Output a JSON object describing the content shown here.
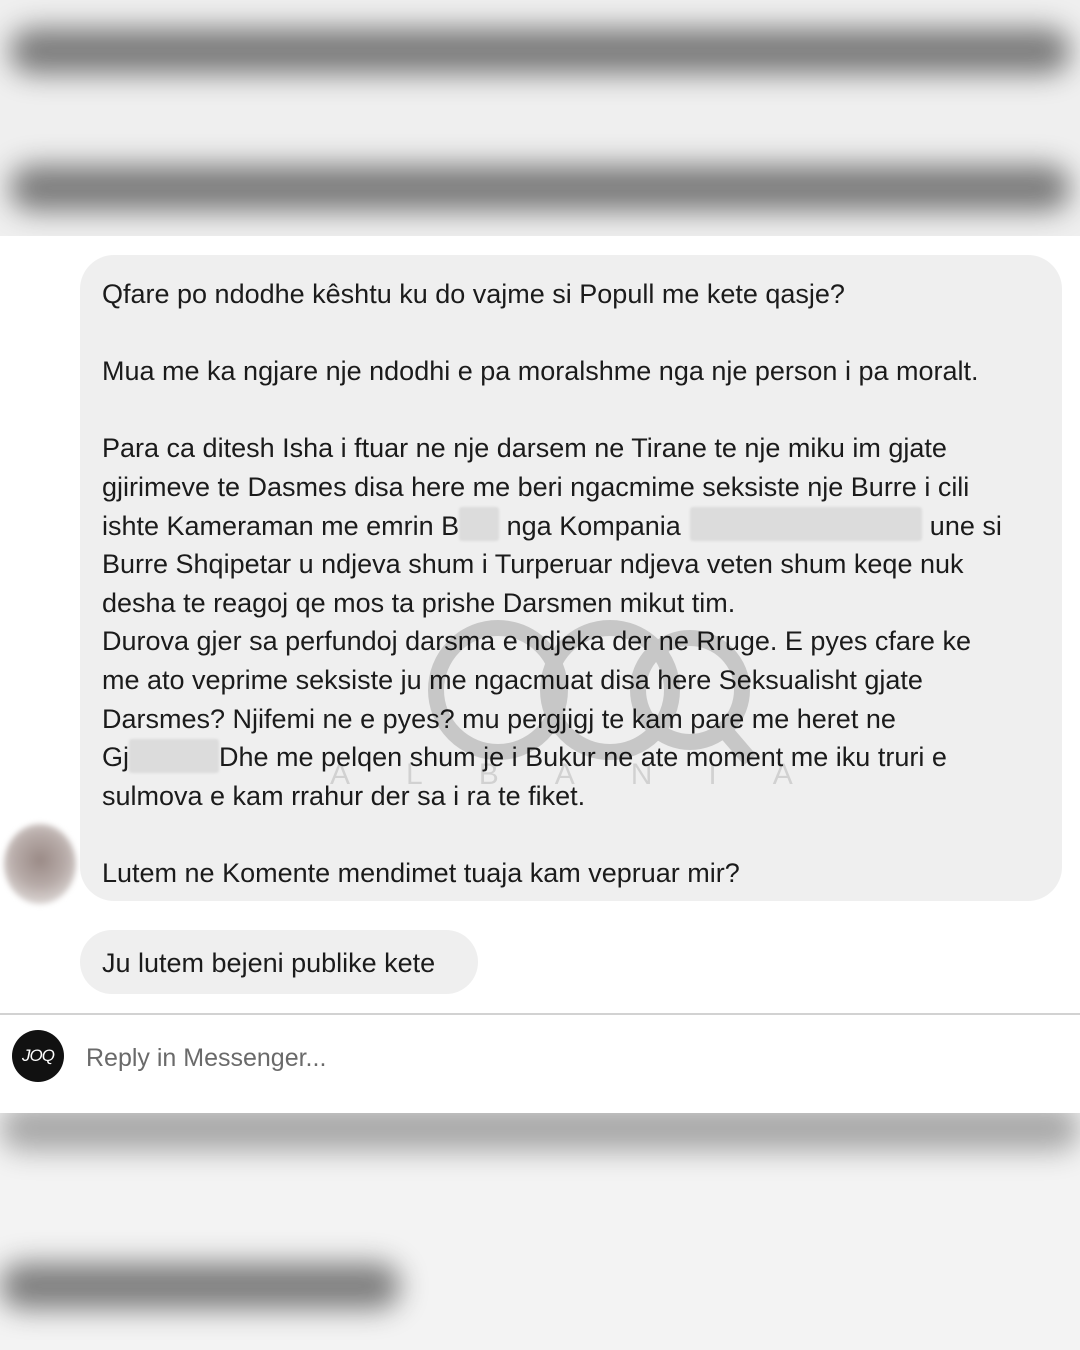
{
  "message_main": {
    "line1": "Qfare po ndodhe kêshtu ku do vajme si Popull me kete qasje?",
    "line2": "Mua me ka ngjare nje ndodhi e pa moralshme nga nje person i pa moralt.",
    "line3": "Para ca ditesh Isha i ftuar ne nje darsem ne Tirane te nje miku im gjate",
    "line4": "gjirimeve te Dasmes disa here me beri ngacmime seksiste nje Burre i cili",
    "line5_a": "ishte Kameraman me emrin B",
    "line5_b": " nga Kompania ",
    "line5_c": "une si",
    "line6": "Burre Shqipetar u ndjeva shum i Turperuar ndjeva veten shum keqe nuk",
    "line7": "desha te reagoj qe mos ta prishe Darsmen mikut tim.",
    "line8": "Durova gjer sa perfundoj darsma e ndjeka der ne Rruge. E pyes cfare ke",
    "line9": "me ato veprime seksiste ju me ngacmuat disa here Seksualisht gjate",
    "line10": "Darsmes? Njifemi ne e pyes? mu pergjigj te kam pare me heret ne",
    "line11_a": "Gj",
    "line11_b": "Dhe me pelqen shum je i Bukur ne ate moment me iku truri e",
    "line12": "sulmova e kam rrahur der sa i ra te fiket.",
    "line13": "Lutem ne Komente mendimet tuaja kam vepruar mir?"
  },
  "message_second": {
    "text": "Ju lutem bejeni publike kete"
  },
  "reply": {
    "placeholder": "Reply in Messenger...",
    "avatar_text": "JOQ"
  },
  "watermark": {
    "brand": "JOQ",
    "sub": "ALBANIA"
  },
  "colors": {
    "bubble": "#efefef",
    "text": "#1b1b1b",
    "panel": "#ffffff",
    "reply_avatar": "#111111"
  }
}
